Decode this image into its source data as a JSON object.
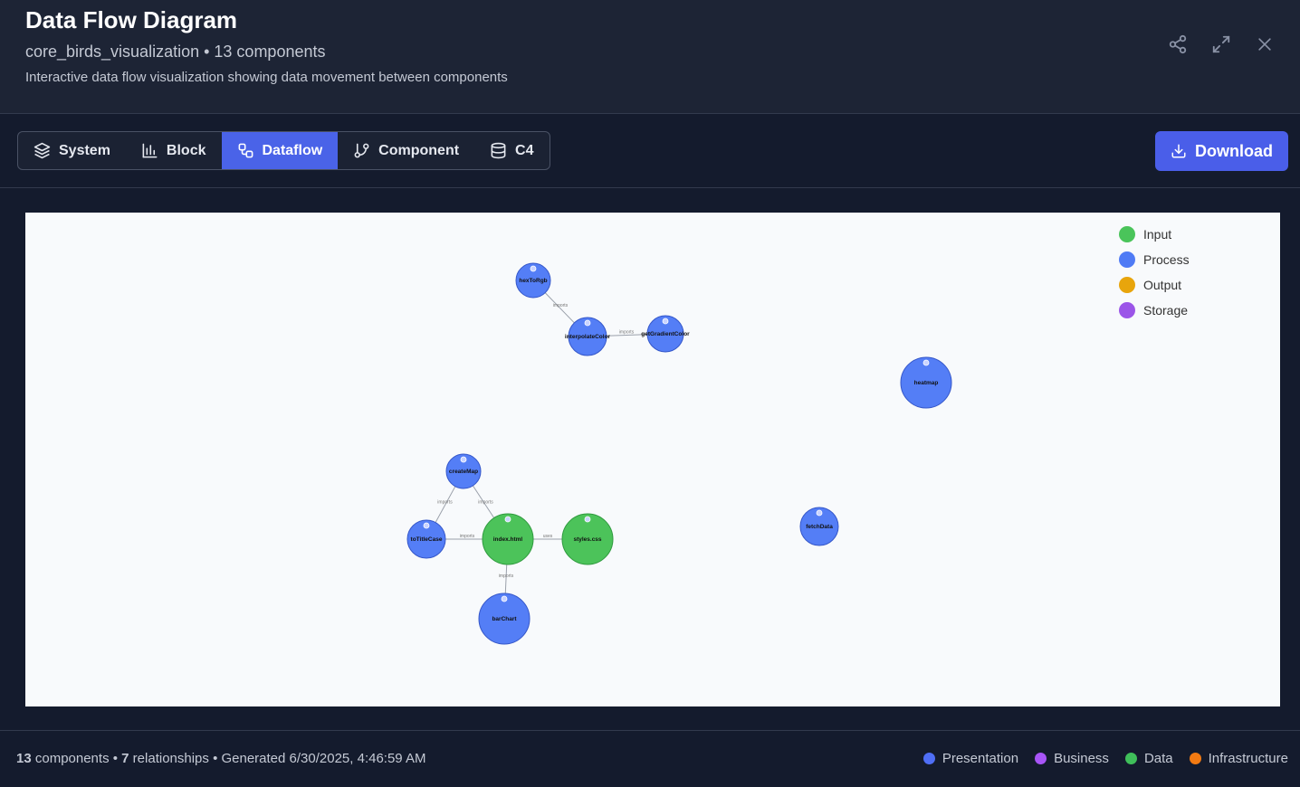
{
  "header": {
    "title": "Data Flow Diagram",
    "subtitle": "core_birds_visualization • 13 components",
    "description": "Interactive data flow visualization showing data movement between components",
    "icons": [
      "share-icon",
      "expand-icon",
      "close-icon"
    ]
  },
  "tabs": [
    {
      "label": "System",
      "icon": "layers-icon"
    },
    {
      "label": "Block",
      "icon": "bar-chart-icon"
    },
    {
      "label": "Dataflow",
      "icon": "workflow-icon",
      "active": true
    },
    {
      "label": "Component",
      "icon": "git-branch-icon"
    },
    {
      "label": "C4",
      "icon": "database-icon"
    }
  ],
  "download_label": "Download",
  "legend": [
    {
      "label": "Input",
      "color": "#4ac45a"
    },
    {
      "label": "Process",
      "color": "#4f7bf5"
    },
    {
      "label": "Output",
      "color": "#e8a50c"
    },
    {
      "label": "Storage",
      "color": "#9b55e8"
    }
  ],
  "diagram": {
    "nodes": [
      {
        "id": "hexToRgb",
        "label": "hexToRgb",
        "type": "process"
      },
      {
        "id": "interpolateColor",
        "label": "interpolateColor",
        "type": "process"
      },
      {
        "id": "getGradientColor",
        "label": "getGradientColor",
        "type": "process"
      },
      {
        "id": "heatmap",
        "label": "heatmap",
        "type": "process"
      },
      {
        "id": "createMap",
        "label": "createMap",
        "type": "process"
      },
      {
        "id": "toTitleCase",
        "label": "toTitleCase",
        "type": "process"
      },
      {
        "id": "index.html",
        "label": "index.html",
        "type": "input"
      },
      {
        "id": "styles.css",
        "label": "styles.css",
        "type": "input"
      },
      {
        "id": "fetchData",
        "label": "fetchData",
        "type": "process"
      },
      {
        "id": "barChart",
        "label": "barChart",
        "type": "process"
      }
    ],
    "edges": [
      {
        "from": "hexToRgb",
        "to": "interpolateColor",
        "label": "imports"
      },
      {
        "from": "interpolateColor",
        "to": "getGradientColor",
        "label": "imports"
      },
      {
        "from": "createMap",
        "to": "toTitleCase",
        "label": "imports"
      },
      {
        "from": "createMap",
        "to": "index.html",
        "label": "imports"
      },
      {
        "from": "toTitleCase",
        "to": "index.html",
        "label": "imports"
      },
      {
        "from": "index.html",
        "to": "styles.css",
        "label": "uses"
      },
      {
        "from": "index.html",
        "to": "barChart",
        "label": "imports"
      }
    ]
  },
  "footer": {
    "components_count": "13",
    "components_label": " components • ",
    "relationships_count": "7",
    "relationships_label": " relationships • Generated 6/30/2025, 4:46:59 AM",
    "layers": [
      {
        "label": "Presentation",
        "color": "#4f6ef5"
      },
      {
        "label": "Business",
        "color": "#a855f7"
      },
      {
        "label": "Data",
        "color": "#3fbf5a"
      },
      {
        "label": "Infrastructure",
        "color": "#f27a12"
      }
    ]
  }
}
